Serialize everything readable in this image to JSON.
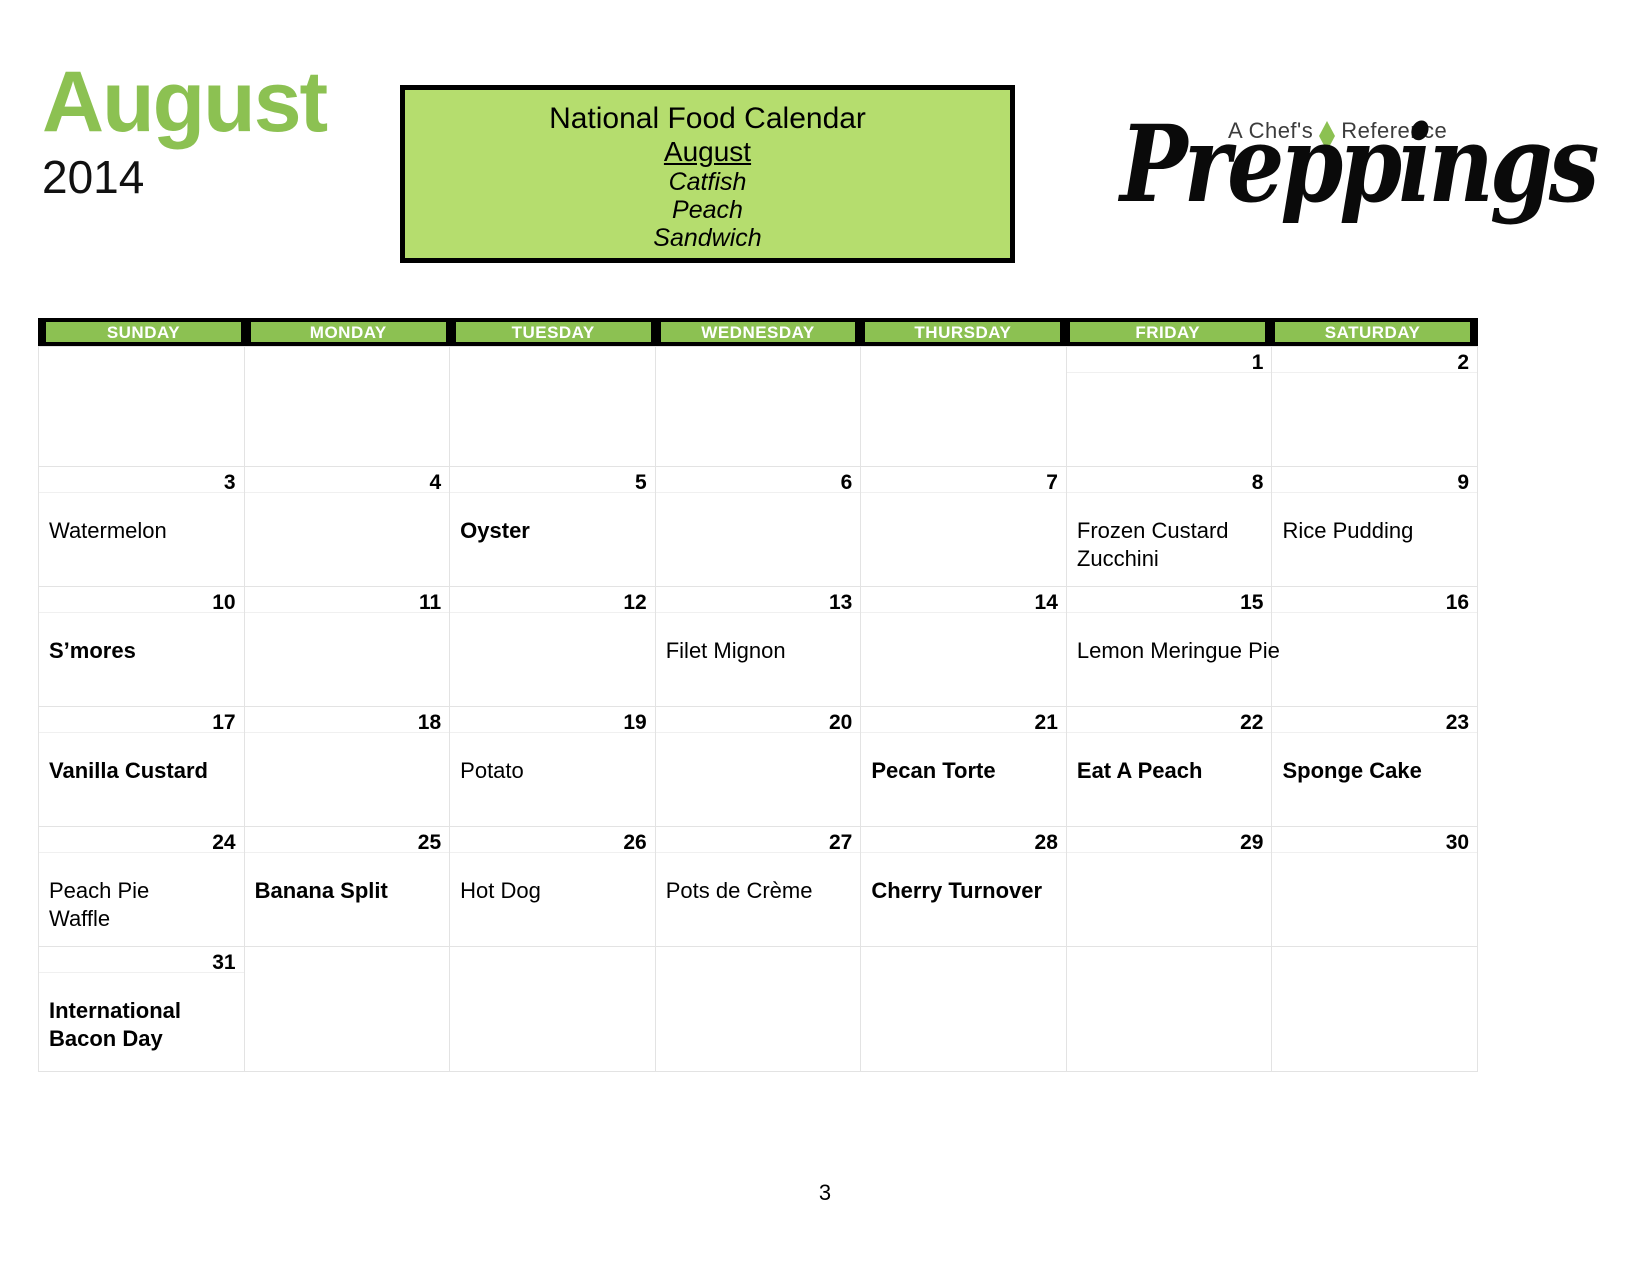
{
  "header": {
    "month": "August",
    "year": "2014",
    "banner": {
      "title": "National Food Calendar",
      "month": "August",
      "items": [
        "Catfish",
        "Peach",
        "Sandwich"
      ]
    },
    "logo": {
      "tagline_left": "A Chef's",
      "tagline_right": "Reference",
      "wordmark": "Preppings"
    }
  },
  "calendar": {
    "day_headers": [
      "SUNDAY",
      "MONDAY",
      "TUESDAY",
      "WEDNESDAY",
      "THURSDAY",
      "FRIDAY",
      "SATURDAY"
    ],
    "weeks": [
      [
        {
          "day": "",
          "events": []
        },
        {
          "day": "",
          "events": []
        },
        {
          "day": "",
          "events": []
        },
        {
          "day": "",
          "events": []
        },
        {
          "day": "",
          "events": []
        },
        {
          "day": "1",
          "events": []
        },
        {
          "day": "2",
          "events": []
        }
      ],
      [
        {
          "day": "3",
          "events": [
            {
              "text": "Watermelon",
              "bold": false
            }
          ]
        },
        {
          "day": "4",
          "events": []
        },
        {
          "day": "5",
          "events": [
            {
              "text": "Oyster",
              "bold": true
            }
          ]
        },
        {
          "day": "6",
          "events": []
        },
        {
          "day": "7",
          "events": []
        },
        {
          "day": "8",
          "events": [
            {
              "text": "Frozen Custard",
              "bold": false
            },
            {
              "text": "Zucchini",
              "bold": false
            }
          ]
        },
        {
          "day": "9",
          "events": [
            {
              "text": "Rice Pudding",
              "bold": false
            }
          ]
        }
      ],
      [
        {
          "day": "10",
          "events": [
            {
              "text": "S’mores",
              "bold": true
            }
          ]
        },
        {
          "day": "11",
          "events": []
        },
        {
          "day": "12",
          "events": []
        },
        {
          "day": "13",
          "events": [
            {
              "text": "Filet Mignon",
              "bold": false
            }
          ]
        },
        {
          "day": "14",
          "events": []
        },
        {
          "day": "15",
          "events": [
            {
              "text": "Lemon Meringue Pie",
              "bold": false
            }
          ]
        },
        {
          "day": "16",
          "events": []
        }
      ],
      [
        {
          "day": "17",
          "events": [
            {
              "text": "Vanilla Custard",
              "bold": true
            }
          ]
        },
        {
          "day": "18",
          "events": []
        },
        {
          "day": "19",
          "events": [
            {
              "text": "Potato",
              "bold": false
            }
          ]
        },
        {
          "day": "20",
          "events": []
        },
        {
          "day": "21",
          "events": [
            {
              "text": "Pecan Torte",
              "bold": true
            }
          ]
        },
        {
          "day": "22",
          "events": [
            {
              "text": "Eat A Peach",
              "bold": true
            }
          ]
        },
        {
          "day": "23",
          "events": [
            {
              "text": "Sponge Cake",
              "bold": true
            }
          ]
        }
      ],
      [
        {
          "day": "24",
          "events": [
            {
              "text": "Peach Pie",
              "bold": false
            },
            {
              "text": "Waffle",
              "bold": false
            }
          ]
        },
        {
          "day": "25",
          "events": [
            {
              "text": "Banana Split",
              "bold": true
            }
          ]
        },
        {
          "day": "26",
          "events": [
            {
              "text": "Hot Dog",
              "bold": false
            }
          ]
        },
        {
          "day": "27",
          "events": [
            {
              "text": "Pots de Crème",
              "bold": false
            }
          ]
        },
        {
          "day": "28",
          "events": [
            {
              "text": "Cherry Turnover",
              "bold": true
            }
          ]
        },
        {
          "day": "29",
          "events": []
        },
        {
          "day": "30",
          "events": []
        }
      ],
      [
        {
          "day": "31",
          "events": [
            {
              "text": "International",
              "bold": true
            },
            {
              "text": "Bacon Day",
              "bold": true
            }
          ]
        },
        {
          "day": "",
          "events": []
        },
        {
          "day": "",
          "events": []
        },
        {
          "day": "",
          "events": []
        },
        {
          "day": "",
          "events": []
        },
        {
          "day": "",
          "events": []
        },
        {
          "day": "",
          "events": []
        }
      ]
    ]
  },
  "footer": {
    "page_number": "3"
  },
  "colors": {
    "accent_green": "#8cc152",
    "banner_green": "#b5dd6e",
    "grid_line": "#e3e3e3"
  }
}
